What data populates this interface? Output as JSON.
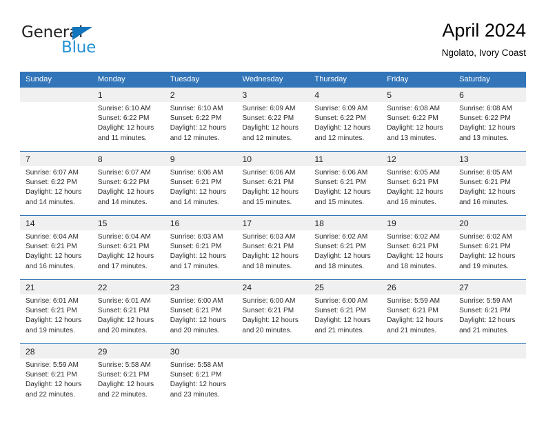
{
  "logo": {
    "word_top": "General",
    "word_bottom": "Blue",
    "triangle_color": "#1275bc",
    "blue_color": "#2492d4"
  },
  "header": {
    "title": "April 2024",
    "subtitle": "Ngolato, Ivory Coast"
  },
  "theme": {
    "header_bg": "#3275b9",
    "header_text": "#ffffff",
    "day_band_bg": "#f0f0f0",
    "rule_color": "#3275b9"
  },
  "weekdays": [
    "Sunday",
    "Monday",
    "Tuesday",
    "Wednesday",
    "Thursday",
    "Friday",
    "Saturday"
  ],
  "labels": {
    "sunrise_prefix": "Sunrise:",
    "sunset_prefix": "Sunset:",
    "daylight_prefix": "Daylight:"
  },
  "weeks": [
    [
      {
        "day": "",
        "sunrise": "",
        "sunset": "",
        "daylight_line1": "",
        "daylight_line2": ""
      },
      {
        "day": "1",
        "sunrise": "Sunrise: 6:10 AM",
        "sunset": "Sunset: 6:22 PM",
        "daylight_line1": "Daylight: 12 hours",
        "daylight_line2": "and 11 minutes."
      },
      {
        "day": "2",
        "sunrise": "Sunrise: 6:10 AM",
        "sunset": "Sunset: 6:22 PM",
        "daylight_line1": "Daylight: 12 hours",
        "daylight_line2": "and 12 minutes."
      },
      {
        "day": "3",
        "sunrise": "Sunrise: 6:09 AM",
        "sunset": "Sunset: 6:22 PM",
        "daylight_line1": "Daylight: 12 hours",
        "daylight_line2": "and 12 minutes."
      },
      {
        "day": "4",
        "sunrise": "Sunrise: 6:09 AM",
        "sunset": "Sunset: 6:22 PM",
        "daylight_line1": "Daylight: 12 hours",
        "daylight_line2": "and 12 minutes."
      },
      {
        "day": "5",
        "sunrise": "Sunrise: 6:08 AM",
        "sunset": "Sunset: 6:22 PM",
        "daylight_line1": "Daylight: 12 hours",
        "daylight_line2": "and 13 minutes."
      },
      {
        "day": "6",
        "sunrise": "Sunrise: 6:08 AM",
        "sunset": "Sunset: 6:22 PM",
        "daylight_line1": "Daylight: 12 hours",
        "daylight_line2": "and 13 minutes."
      }
    ],
    [
      {
        "day": "7",
        "sunrise": "Sunrise: 6:07 AM",
        "sunset": "Sunset: 6:22 PM",
        "daylight_line1": "Daylight: 12 hours",
        "daylight_line2": "and 14 minutes."
      },
      {
        "day": "8",
        "sunrise": "Sunrise: 6:07 AM",
        "sunset": "Sunset: 6:22 PM",
        "daylight_line1": "Daylight: 12 hours",
        "daylight_line2": "and 14 minutes."
      },
      {
        "day": "9",
        "sunrise": "Sunrise: 6:06 AM",
        "sunset": "Sunset: 6:21 PM",
        "daylight_line1": "Daylight: 12 hours",
        "daylight_line2": "and 14 minutes."
      },
      {
        "day": "10",
        "sunrise": "Sunrise: 6:06 AM",
        "sunset": "Sunset: 6:21 PM",
        "daylight_line1": "Daylight: 12 hours",
        "daylight_line2": "and 15 minutes."
      },
      {
        "day": "11",
        "sunrise": "Sunrise: 6:06 AM",
        "sunset": "Sunset: 6:21 PM",
        "daylight_line1": "Daylight: 12 hours",
        "daylight_line2": "and 15 minutes."
      },
      {
        "day": "12",
        "sunrise": "Sunrise: 6:05 AM",
        "sunset": "Sunset: 6:21 PM",
        "daylight_line1": "Daylight: 12 hours",
        "daylight_line2": "and 16 minutes."
      },
      {
        "day": "13",
        "sunrise": "Sunrise: 6:05 AM",
        "sunset": "Sunset: 6:21 PM",
        "daylight_line1": "Daylight: 12 hours",
        "daylight_line2": "and 16 minutes."
      }
    ],
    [
      {
        "day": "14",
        "sunrise": "Sunrise: 6:04 AM",
        "sunset": "Sunset: 6:21 PM",
        "daylight_line1": "Daylight: 12 hours",
        "daylight_line2": "and 16 minutes."
      },
      {
        "day": "15",
        "sunrise": "Sunrise: 6:04 AM",
        "sunset": "Sunset: 6:21 PM",
        "daylight_line1": "Daylight: 12 hours",
        "daylight_line2": "and 17 minutes."
      },
      {
        "day": "16",
        "sunrise": "Sunrise: 6:03 AM",
        "sunset": "Sunset: 6:21 PM",
        "daylight_line1": "Daylight: 12 hours",
        "daylight_line2": "and 17 minutes."
      },
      {
        "day": "17",
        "sunrise": "Sunrise: 6:03 AM",
        "sunset": "Sunset: 6:21 PM",
        "daylight_line1": "Daylight: 12 hours",
        "daylight_line2": "and 18 minutes."
      },
      {
        "day": "18",
        "sunrise": "Sunrise: 6:02 AM",
        "sunset": "Sunset: 6:21 PM",
        "daylight_line1": "Daylight: 12 hours",
        "daylight_line2": "and 18 minutes."
      },
      {
        "day": "19",
        "sunrise": "Sunrise: 6:02 AM",
        "sunset": "Sunset: 6:21 PM",
        "daylight_line1": "Daylight: 12 hours",
        "daylight_line2": "and 18 minutes."
      },
      {
        "day": "20",
        "sunrise": "Sunrise: 6:02 AM",
        "sunset": "Sunset: 6:21 PM",
        "daylight_line1": "Daylight: 12 hours",
        "daylight_line2": "and 19 minutes."
      }
    ],
    [
      {
        "day": "21",
        "sunrise": "Sunrise: 6:01 AM",
        "sunset": "Sunset: 6:21 PM",
        "daylight_line1": "Daylight: 12 hours",
        "daylight_line2": "and 19 minutes."
      },
      {
        "day": "22",
        "sunrise": "Sunrise: 6:01 AM",
        "sunset": "Sunset: 6:21 PM",
        "daylight_line1": "Daylight: 12 hours",
        "daylight_line2": "and 20 minutes."
      },
      {
        "day": "23",
        "sunrise": "Sunrise: 6:00 AM",
        "sunset": "Sunset: 6:21 PM",
        "daylight_line1": "Daylight: 12 hours",
        "daylight_line2": "and 20 minutes."
      },
      {
        "day": "24",
        "sunrise": "Sunrise: 6:00 AM",
        "sunset": "Sunset: 6:21 PM",
        "daylight_line1": "Daylight: 12 hours",
        "daylight_line2": "and 20 minutes."
      },
      {
        "day": "25",
        "sunrise": "Sunrise: 6:00 AM",
        "sunset": "Sunset: 6:21 PM",
        "daylight_line1": "Daylight: 12 hours",
        "daylight_line2": "and 21 minutes."
      },
      {
        "day": "26",
        "sunrise": "Sunrise: 5:59 AM",
        "sunset": "Sunset: 6:21 PM",
        "daylight_line1": "Daylight: 12 hours",
        "daylight_line2": "and 21 minutes."
      },
      {
        "day": "27",
        "sunrise": "Sunrise: 5:59 AM",
        "sunset": "Sunset: 6:21 PM",
        "daylight_line1": "Daylight: 12 hours",
        "daylight_line2": "and 21 minutes."
      }
    ],
    [
      {
        "day": "28",
        "sunrise": "Sunrise: 5:59 AM",
        "sunset": "Sunset: 6:21 PM",
        "daylight_line1": "Daylight: 12 hours",
        "daylight_line2": "and 22 minutes."
      },
      {
        "day": "29",
        "sunrise": "Sunrise: 5:58 AM",
        "sunset": "Sunset: 6:21 PM",
        "daylight_line1": "Daylight: 12 hours",
        "daylight_line2": "and 22 minutes."
      },
      {
        "day": "30",
        "sunrise": "Sunrise: 5:58 AM",
        "sunset": "Sunset: 6:21 PM",
        "daylight_line1": "Daylight: 12 hours",
        "daylight_line2": "and 23 minutes."
      },
      {
        "day": "",
        "sunrise": "",
        "sunset": "",
        "daylight_line1": "",
        "daylight_line2": ""
      },
      {
        "day": "",
        "sunrise": "",
        "sunset": "",
        "daylight_line1": "",
        "daylight_line2": ""
      },
      {
        "day": "",
        "sunrise": "",
        "sunset": "",
        "daylight_line1": "",
        "daylight_line2": ""
      },
      {
        "day": "",
        "sunrise": "",
        "sunset": "",
        "daylight_line1": "",
        "daylight_line2": ""
      }
    ]
  ]
}
